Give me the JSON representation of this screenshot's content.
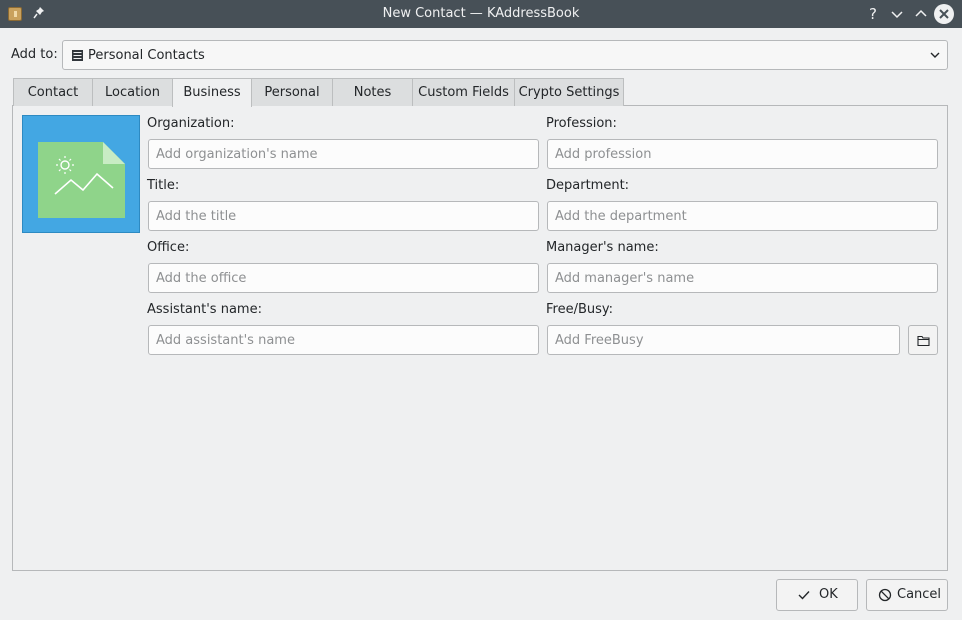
{
  "window": {
    "title": "New Contact — KAddressBook",
    "help_label": "?",
    "minimize_label": "⌄",
    "maximize_label": "⌃",
    "close_label": "✕"
  },
  "addto": {
    "label": "Add to:",
    "value": "Personal Contacts"
  },
  "tabs": [
    {
      "label": "Contact"
    },
    {
      "label": "Location"
    },
    {
      "label": "Business",
      "active": true
    },
    {
      "label": "Personal"
    },
    {
      "label": "Notes"
    },
    {
      "label": "Custom Fields"
    },
    {
      "label": "Crypto Settings"
    }
  ],
  "fields": {
    "organization": {
      "label": "Organization:",
      "placeholder": "Add organization's name",
      "value": ""
    },
    "profession": {
      "label": "Profession:",
      "placeholder": "Add profession",
      "value": ""
    },
    "title": {
      "label": "Title:",
      "placeholder": "Add the title",
      "value": ""
    },
    "department": {
      "label": "Department:",
      "placeholder": "Add the department",
      "value": ""
    },
    "office": {
      "label": "Office:",
      "placeholder": "Add the office",
      "value": ""
    },
    "manager": {
      "label": "Manager's name:",
      "placeholder": "Add manager's name",
      "value": ""
    },
    "assistant": {
      "label": "Assistant's name:",
      "placeholder": "Add assistant's name",
      "value": ""
    },
    "freebusy": {
      "label": "Free/Busy:",
      "placeholder": "Add FreeBusy",
      "value": ""
    }
  },
  "buttons": {
    "ok": "OK",
    "cancel": "Cancel"
  },
  "icons": {
    "app": "kaddressbook-icon",
    "pin": "pin-icon",
    "addressbook": "addressbook-icon",
    "photo": "image-placeholder-icon",
    "folder": "folder-icon",
    "ok": "checkmark-icon",
    "cancel": "cancel-icon"
  },
  "colors": {
    "titlebar": "#475057",
    "window_bg": "#eff0f1",
    "photo_bg": "#43a7e3",
    "photo_sheet": "#8fd48a"
  }
}
